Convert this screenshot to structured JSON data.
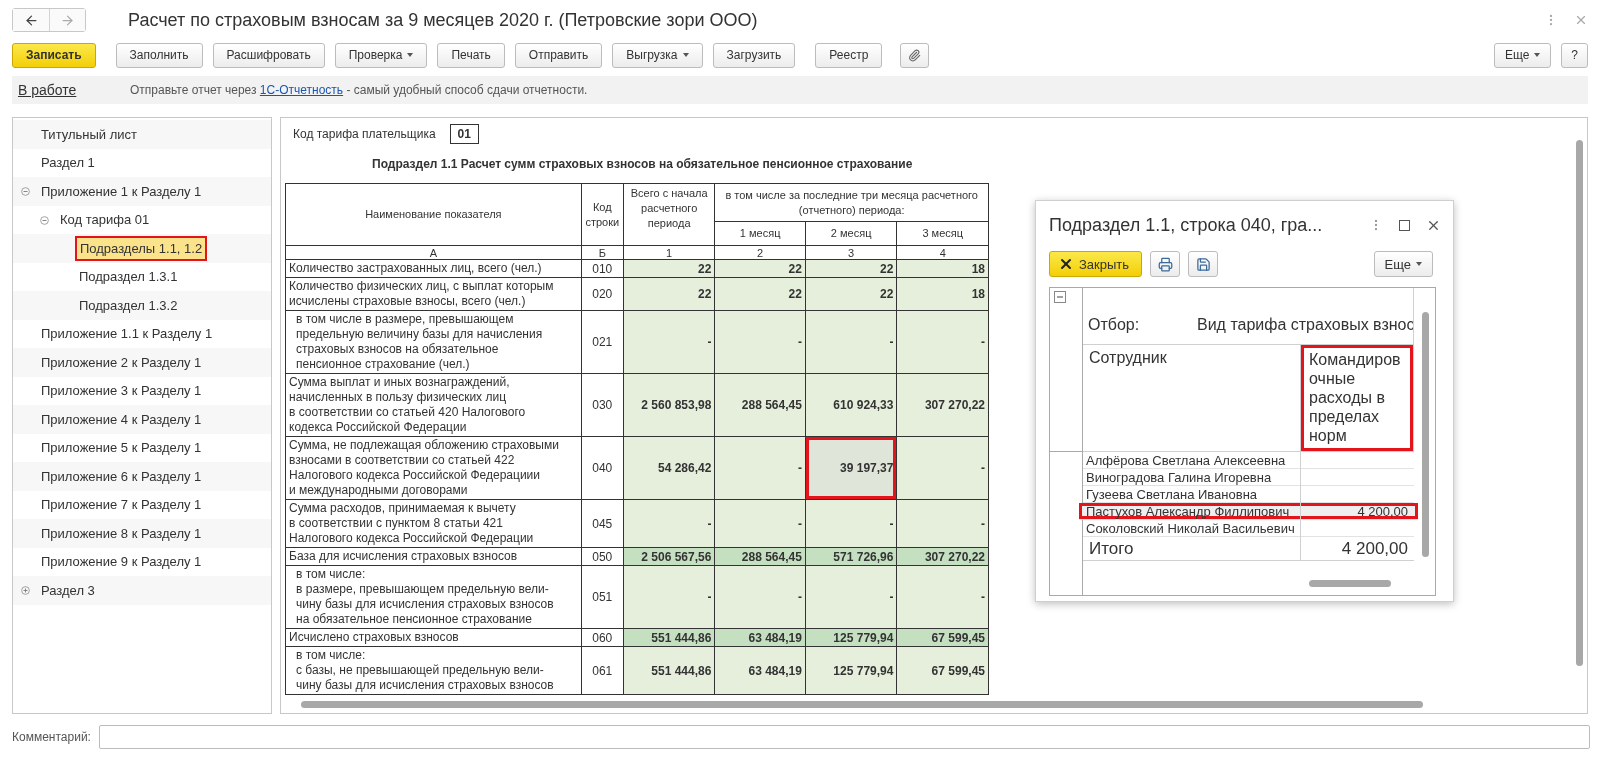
{
  "window": {
    "title": "Расчет по страховым взносам за 9 месяцев 2020 г. (Петровские зори ООО)"
  },
  "toolbar": {
    "buttons": [
      {
        "label": "Записать",
        "kind": "primary",
        "dropdown": false
      },
      {
        "label": "Заполнить",
        "kind": "normal",
        "dropdown": false
      },
      {
        "label": "Расшифровать",
        "kind": "normal",
        "dropdown": false
      },
      {
        "label": "Проверка",
        "kind": "normal",
        "dropdown": true
      },
      {
        "label": "Печать",
        "kind": "normal",
        "dropdown": false
      },
      {
        "label": "Отправить",
        "kind": "normal",
        "dropdown": false
      },
      {
        "label": "Выгрузка",
        "kind": "normal",
        "dropdown": true
      },
      {
        "label": "Загрузить",
        "kind": "normal",
        "dropdown": false
      },
      {
        "label": "Реестр",
        "kind": "normal",
        "dropdown": false
      },
      {
        "kind": "attach"
      }
    ],
    "right_buttons": [
      {
        "label": "Еще",
        "dropdown": true
      },
      {
        "label": "?",
        "dropdown": false
      }
    ]
  },
  "status": {
    "state": "В работе",
    "message_before": "Отправьте отчет через ",
    "link": "1С-Отчетность",
    "message_after": " - самый удобный способ сдачи отчетности."
  },
  "tree": [
    {
      "label": "Титульный лист",
      "selected": false
    },
    {
      "label": "Раздел 1",
      "selected": false
    },
    {
      "label": "Приложение 1 к Разделу 1",
      "selected": false,
      "expanded": true,
      "children": [
        {
          "label": "Код тарифа 01",
          "selected": false,
          "expanded": true,
          "children": [
            {
              "label": "Подразделы 1.1, 1.2",
              "selected": true
            },
            {
              "label": "Подраздел 1.3.1",
              "selected": false
            },
            {
              "label": "Подраздел 1.3.2",
              "selected": false
            }
          ]
        }
      ]
    },
    {
      "label": "Приложение 1.1 к Разделу 1",
      "selected": false
    },
    {
      "label": "Приложение 2 к Разделу 1",
      "selected": false
    },
    {
      "label": "Приложение 3 к Разделу 1",
      "selected": false
    },
    {
      "label": "Приложение 4 к Разделу 1",
      "selected": false
    },
    {
      "label": "Приложение 5 к Разделу 1",
      "selected": false
    },
    {
      "label": "Приложение 6 к Разделу 1",
      "selected": false
    },
    {
      "label": "Приложение 7 к Разделу 1",
      "selected": false
    },
    {
      "label": "Приложение 8 к Разделу 1",
      "selected": false
    },
    {
      "label": "Приложение 9 к Разделу 1",
      "selected": false
    },
    {
      "label": "Раздел 3",
      "selected": false,
      "expanded": false
    }
  ],
  "document": {
    "tariff_label": "Код тарифа плательщика",
    "tariff_code": "01",
    "heading": "Подраздел 1.1 Расчет сумм страховых взносов на обязательное пенсионное страхование",
    "header": {
      "name": "Наименование показателя",
      "code": "Код строки",
      "total": "Всего с начала расчетного периода",
      "group": "в том числе за последние три месяца расчетного (отчетного) периода:",
      "months": [
        "1 месяц",
        "2 месяц",
        "3 месяц"
      ],
      "letters": [
        "А",
        "Б",
        "1",
        "2",
        "3",
        "4"
      ]
    },
    "rows": [
      {
        "label": "Количество застрахованных лиц, всего (чел.)",
        "code": "010",
        "kind": "input",
        "indented": false,
        "cells": [
          {
            "value": "22",
            "selected": false
          },
          {
            "value": "22",
            "selected": false
          },
          {
            "value": "22",
            "selected": false
          },
          {
            "value": "18",
            "selected": false
          }
        ]
      },
      {
        "label": "Количество физических лиц, с выплат которым\nисчислены страховые взносы, всего (чел.)",
        "code": "020",
        "kind": "input",
        "indented": false,
        "cells": [
          {
            "value": "22",
            "selected": false
          },
          {
            "value": "22",
            "selected": false
          },
          {
            "value": "22",
            "selected": false
          },
          {
            "value": "18",
            "selected": false
          }
        ]
      },
      {
        "label": "в том числе в размере, превышающем\nпредельную величину базы для начисления\nстраховых взносов на обязательное\nпенсионное страхование (чел.)",
        "code": "021",
        "kind": "input",
        "indented": true,
        "cells": [
          {
            "value": "-",
            "selected": false
          },
          {
            "value": "-",
            "selected": false
          },
          {
            "value": "-",
            "selected": false
          },
          {
            "value": "-",
            "selected": false
          }
        ]
      },
      {
        "label": "Сумма выплат и иных вознаграждений,\nначисленных в пользу физических лиц\nв соответствии со статьей 420 Налогового\nкодекса Российской Федерации",
        "code": "030",
        "kind": "input",
        "indented": false,
        "cells": [
          {
            "value": "2 560 853,98",
            "selected": false
          },
          {
            "value": "288 564,45",
            "selected": false
          },
          {
            "value": "610 924,33",
            "selected": false
          },
          {
            "value": "307 270,22",
            "selected": false
          }
        ]
      },
      {
        "label": "Сумма, не подлежащая обложению страховыми\nвзносами в соответствии со статьей 422\nНалогового кодекса Российской Федерациии\nи международными договорами",
        "code": "040",
        "kind": "input",
        "indented": false,
        "cells": [
          {
            "value": "54 286,42",
            "selected": false
          },
          {
            "value": "-",
            "selected": false
          },
          {
            "value": "39 197,37",
            "selected": true
          },
          {
            "value": "-",
            "selected": false
          }
        ]
      },
      {
        "label": "Сумма расходов, принимаемая к вычету\nв соответствии с пунктом 8 статьи 421\nНалогового кодекса Российской Федерации",
        "code": "045",
        "kind": "input",
        "indented": false,
        "cells": [
          {
            "value": "-",
            "selected": false
          },
          {
            "value": "-",
            "selected": false
          },
          {
            "value": "-",
            "selected": false
          },
          {
            "value": "-",
            "selected": false
          }
        ]
      },
      {
        "label": "База для исчисления страховых взносов",
        "code": "050",
        "kind": "total",
        "indented": false,
        "cells": [
          {
            "value": "2 506 567,56",
            "selected": false
          },
          {
            "value": "288 564,45",
            "selected": false
          },
          {
            "value": "571 726,96",
            "selected": false
          },
          {
            "value": "307 270,22",
            "selected": false
          }
        ]
      },
      {
        "label": "в том числе:\nв размере, превышающем предельную вели-\nчину базы для исчисления страховых взносов\nна обязательное пенсионное страхование",
        "code": "051",
        "kind": "input",
        "indented": true,
        "cells": [
          {
            "value": "-",
            "selected": false
          },
          {
            "value": "-",
            "selected": false
          },
          {
            "value": "-",
            "selected": false
          },
          {
            "value": "-",
            "selected": false
          }
        ]
      },
      {
        "label": "Исчислено страховых взносов",
        "code": "060",
        "kind": "total",
        "indented": false,
        "cells": [
          {
            "value": "551 444,86",
            "selected": false
          },
          {
            "value": "63 484,19",
            "selected": false
          },
          {
            "value": "125 779,94",
            "selected": false
          },
          {
            "value": "67 599,45",
            "selected": false
          }
        ]
      },
      {
        "label": "в том числе:\nс базы, не превышающей предельную вели-\nчину базы для исчисления страховых взносов",
        "code": "061",
        "kind": "input",
        "indented": true,
        "cells": [
          {
            "value": "551 444,86",
            "selected": false
          },
          {
            "value": "63 484,19",
            "selected": false
          },
          {
            "value": "125 779,94",
            "selected": false
          },
          {
            "value": "67 599,45",
            "selected": false
          }
        ]
      }
    ]
  },
  "dialog": {
    "title": "Подраздел 1.1, строка 040, гра...",
    "close_button": "Закрыть",
    "more_button": "Еще",
    "filter_label": "Отбор:",
    "filter_value": "Вид тарифа страховых взнос",
    "columns": [
      {
        "label": "Сотрудник",
        "highlighted": false
      },
      {
        "label": "Командировочные расходы в пределах норм",
        "highlighted": true
      }
    ],
    "rows": [
      {
        "name": "Алфёрова Светлана Алексеевна",
        "selected": false
      },
      {
        "name": "Виноградова Галина Игоревна",
        "selected": false
      },
      {
        "name": "Гузеева Светлана Ивановна",
        "selected": false
      },
      {
        "name": "Пастухов Александр Филлипович",
        "value": "4 200,00",
        "selected": true
      },
      {
        "name": "Соколовский Николай Васильевич",
        "selected": false
      }
    ],
    "total": {
      "label": "Итого",
      "value": "4 200,00"
    }
  },
  "comment": {
    "label": "Комментарий:"
  }
}
